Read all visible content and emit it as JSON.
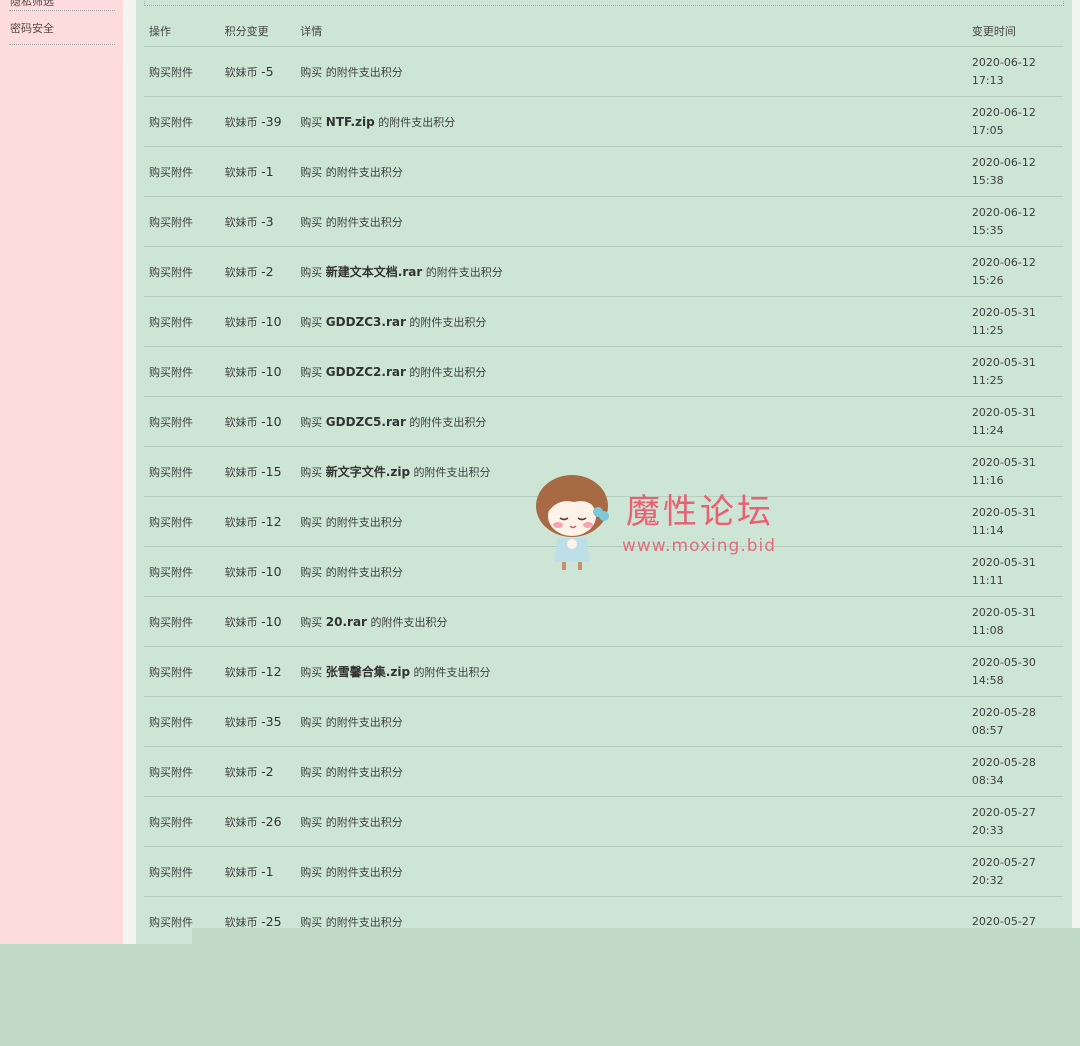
{
  "sidebar": {
    "items": [
      {
        "label": "隐私筛选"
      },
      {
        "label": "密码安全"
      }
    ]
  },
  "table": {
    "headers": {
      "op": "操作",
      "change": "积分变更",
      "detail": "详情",
      "time": "变更时间"
    },
    "rows": [
      {
        "op": "购买附件",
        "currency": "软妹币",
        "amount": "-5",
        "pre": "购买",
        "file": "",
        "post": "的附件支出积分",
        "date": "2020-06-12",
        "clock": "17:13"
      },
      {
        "op": "购买附件",
        "currency": "软妹币",
        "amount": "-39",
        "pre": "购买",
        "file": "NTF.zip",
        "post": "的附件支出积分",
        "date": "2020-06-12",
        "clock": "17:05"
      },
      {
        "op": "购买附件",
        "currency": "软妹币",
        "amount": "-1",
        "pre": "购买",
        "file": "",
        "post": "的附件支出积分",
        "date": "2020-06-12",
        "clock": "15:38"
      },
      {
        "op": "购买附件",
        "currency": "软妹币",
        "amount": "-3",
        "pre": "购买",
        "file": "",
        "post": "的附件支出积分",
        "date": "2020-06-12",
        "clock": "15:35"
      },
      {
        "op": "购买附件",
        "currency": "软妹币",
        "amount": "-2",
        "pre": "购买",
        "file": "新建文本文档.rar",
        "post": "的附件支出积分",
        "date": "2020-06-12",
        "clock": "15:26"
      },
      {
        "op": "购买附件",
        "currency": "软妹币",
        "amount": "-10",
        "pre": "购买",
        "file": "GDDZC3.rar",
        "post": "的附件支出积分",
        "date": "2020-05-31",
        "clock": "11:25"
      },
      {
        "op": "购买附件",
        "currency": "软妹币",
        "amount": "-10",
        "pre": "购买",
        "file": "GDDZC2.rar",
        "post": "的附件支出积分",
        "date": "2020-05-31",
        "clock": "11:25"
      },
      {
        "op": "购买附件",
        "currency": "软妹币",
        "amount": "-10",
        "pre": "购买",
        "file": "GDDZC5.rar",
        "post": "的附件支出积分",
        "date": "2020-05-31",
        "clock": "11:24"
      },
      {
        "op": "购买附件",
        "currency": "软妹币",
        "amount": "-15",
        "pre": "购买",
        "file": "新文字文件.zip",
        "post": "的附件支出积分",
        "date": "2020-05-31",
        "clock": "11:16"
      },
      {
        "op": "购买附件",
        "currency": "软妹币",
        "amount": "-12",
        "pre": "购买",
        "file": "",
        "post": "的附件支出积分",
        "date": "2020-05-31",
        "clock": "11:14"
      },
      {
        "op": "购买附件",
        "currency": "软妹币",
        "amount": "-10",
        "pre": "购买",
        "file": "",
        "post": "的附件支出积分",
        "date": "2020-05-31",
        "clock": "11:11"
      },
      {
        "op": "购买附件",
        "currency": "软妹币",
        "amount": "-10",
        "pre": "购买",
        "file": "20.rar",
        "post": "的附件支出积分",
        "date": "2020-05-31",
        "clock": "11:08"
      },
      {
        "op": "购买附件",
        "currency": "软妹币",
        "amount": "-12",
        "pre": "购买",
        "file": "张雪馨合集.zip",
        "post": "的附件支出积分",
        "date": "2020-05-30",
        "clock": "14:58"
      },
      {
        "op": "购买附件",
        "currency": "软妹币",
        "amount": "-35",
        "pre": "购买",
        "file": "",
        "post": "的附件支出积分",
        "date": "2020-05-28",
        "clock": "08:57"
      },
      {
        "op": "购买附件",
        "currency": "软妹币",
        "amount": "-2",
        "pre": "购买",
        "file": "",
        "post": "的附件支出积分",
        "date": "2020-05-28",
        "clock": "08:34"
      },
      {
        "op": "购买附件",
        "currency": "软妹币",
        "amount": "-26",
        "pre": "购买",
        "file": "",
        "post": "的附件支出积分",
        "date": "2020-05-27",
        "clock": "20:33"
      },
      {
        "op": "购买附件",
        "currency": "软妹币",
        "amount": "-1",
        "pre": "购买",
        "file": "",
        "post": "的附件支出积分",
        "date": "2020-05-27",
        "clock": "20:32"
      },
      {
        "op": "购买附件",
        "currency": "软妹币",
        "amount": "-25",
        "pre": "购买",
        "file": "",
        "post": "的附件支出积分",
        "date": "2020-05-27",
        "clock": ""
      }
    ]
  },
  "watermark": {
    "title": "魔性论坛",
    "url": "www.moxing.bid"
  },
  "colors": {
    "sidebar_bg": "#fcdcdd",
    "main_bg": "#cce5d4",
    "page_bg": "#c0d8c6",
    "watermark": "#ea5f73"
  }
}
